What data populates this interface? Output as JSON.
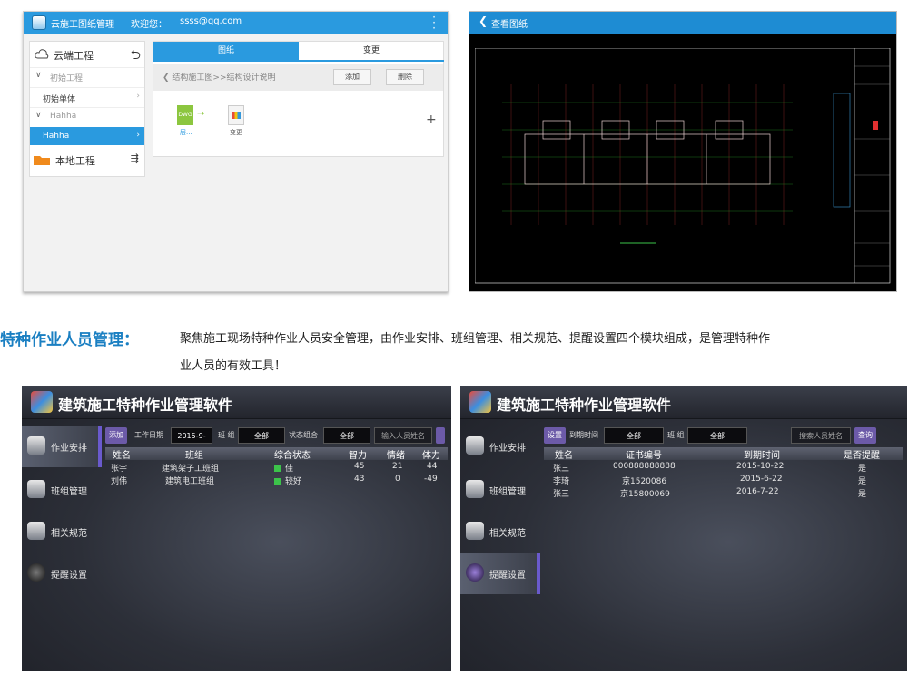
{
  "cloud_app": {
    "title": "云施工图纸管理",
    "welcome_label": "欢迎您：",
    "user_email": "ssss@qq.com",
    "left_panel": {
      "cloud_project_label": "云端工程",
      "items": [
        {
          "label": "初始工程",
          "type": "group"
        },
        {
          "label": "初始单体",
          "type": "item"
        },
        {
          "label": "Hahha",
          "type": "group"
        },
        {
          "label": "Hahha",
          "type": "item",
          "selected": true
        }
      ],
      "local_project_label": "本地工程"
    },
    "tabs": [
      {
        "label": "图纸",
        "active": true
      },
      {
        "label": "变更",
        "active": false
      }
    ],
    "breadcrumb": "结构施工图>>结构设计说明",
    "add_button": "添加",
    "delete_button": "删除",
    "files": [
      {
        "badge": "DWG",
        "label": "一层..."
      },
      {
        "label": "变更"
      }
    ],
    "plus_icon": "plus-icon"
  },
  "cad_viewer": {
    "back_label": "查看图纸"
  },
  "feature": {
    "title": "特种作业人员管理：",
    "desc_line1": "聚焦施工现场特种作业人员安全管理，由作业安排、班组管理、相关规范、提醒设置四个模块组成，是管理特种作",
    "desc_line2": "业人员的有效工具！"
  },
  "app_left": {
    "title": "建筑施工特种作业管理软件",
    "sidebar": [
      {
        "label": "作业安排",
        "active": true
      },
      {
        "label": "班组管理",
        "active": false
      },
      {
        "label": "相关规范",
        "active": false
      },
      {
        "label": "提醒设置",
        "active": false
      }
    ],
    "toolbar": {
      "add": "添加",
      "work_date_label": "工作日期",
      "work_date_value": "2015-9-",
      "team_label": "班 组",
      "team_value": "全部",
      "status_label": "状态组合",
      "status_value": "全部",
      "name_placeholder": "输入人员姓名"
    },
    "columns": [
      "姓名",
      "班组",
      "综合状态",
      "智力",
      "情绪",
      "体力"
    ],
    "rows": [
      {
        "name": "张宇",
        "team": "建筑架子工班组",
        "status": "佳",
        "intellect": "45",
        "mood": "21",
        "physical": "44"
      },
      {
        "name": "刘伟",
        "team": "建筑电工班组",
        "status": "较好",
        "intellect": "43",
        "mood": "0",
        "physical": "-49"
      }
    ]
  },
  "app_right": {
    "title": "建筑施工特种作业管理软件",
    "sidebar": [
      {
        "label": "作业安排",
        "active": false
      },
      {
        "label": "班组管理",
        "active": false
      },
      {
        "label": "相关规范",
        "active": false
      },
      {
        "label": "提醒设置",
        "active": true
      }
    ],
    "toolbar": {
      "settings": "设置",
      "expiry_label": "到期时间",
      "expiry_value": "全部",
      "team_label": "班 组",
      "team_value": "全部",
      "search_placeholder": "搜索人员姓名",
      "query": "查询"
    },
    "columns": [
      "姓名",
      "证书编号",
      "到期时间",
      "是否提醒"
    ],
    "rows": [
      {
        "name": "张三",
        "cert": "000888888888",
        "expiry": "2015-10-22",
        "remind": "是"
      },
      {
        "name": "李琦",
        "cert": "京1520086",
        "expiry": "2015-6-22",
        "remind": "是"
      },
      {
        "name": "张三",
        "cert": "京15800069",
        "expiry": "2016-7-22",
        "remind": "是"
      }
    ]
  }
}
